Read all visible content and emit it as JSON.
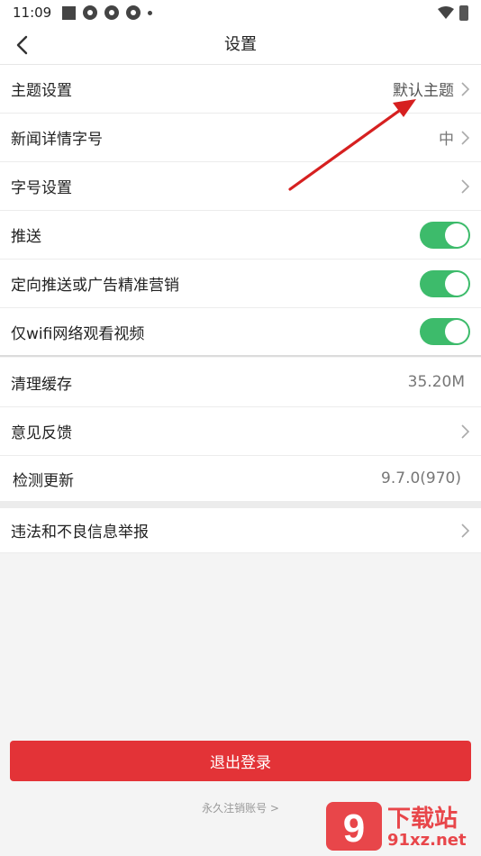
{
  "status": {
    "time": "11:09"
  },
  "header": {
    "title": "设置"
  },
  "rows": [
    {
      "label": "主题设置",
      "value": "默认主题"
    },
    {
      "label": "新闻详情字号",
      "value": "中"
    },
    {
      "label": "字号设置",
      "value": ""
    },
    {
      "label": "推送",
      "toggle": true
    },
    {
      "label": "定向推送或广告精准营销",
      "toggle": true
    },
    {
      "label": "仅wifi网络观看视频",
      "toggle": true
    },
    {
      "label": "清理缓存",
      "value": "35.20M"
    },
    {
      "label": "意见反馈",
      "value": ""
    },
    {
      "label": "检测更新",
      "value": "9.7.0(970)"
    },
    {
      "label": "违法和不良信息举报",
      "value": ""
    }
  ],
  "footer": {
    "logout_label": "退出登录",
    "cancel_account_label": "永久注销账号 >"
  },
  "watermark": {
    "logo": "9",
    "text": "下载站",
    "url": "91xz.net"
  },
  "colors": {
    "accent": "#e33337",
    "toggle_on": "#3dbb6b",
    "annotation_arrow": "#d62020"
  }
}
